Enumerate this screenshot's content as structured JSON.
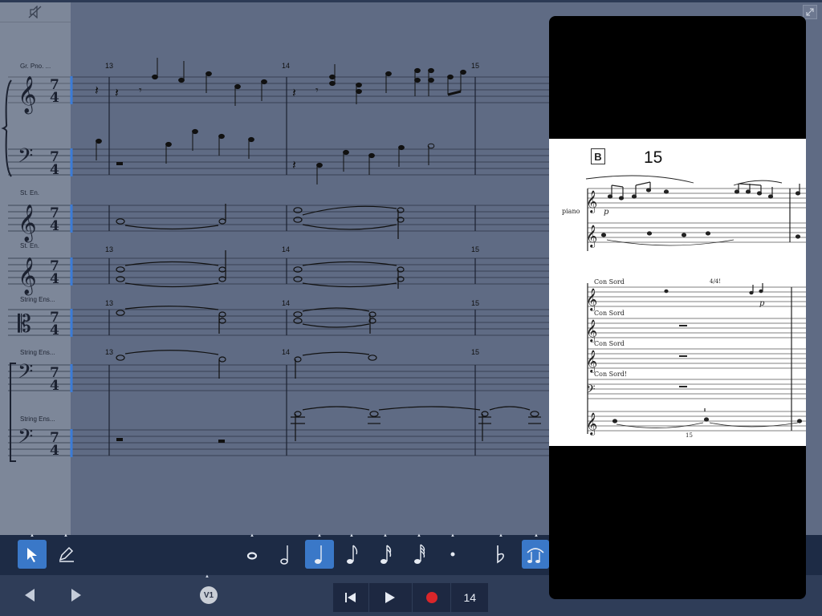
{
  "score": {
    "labels": [
      "Gr. Pno. ...",
      "St. En.",
      "St. En.",
      "String Ens...",
      "String Ens...",
      "String Ens..."
    ],
    "measures": [
      "13",
      "14",
      "15"
    ],
    "time_signature_top": "7",
    "time_signature_bottom": "4"
  },
  "toolbar": {
    "tools": [
      {
        "icon": "pointer-icon",
        "active": true
      },
      {
        "icon": "pencil-icon",
        "active": false
      }
    ],
    "note_values": [
      {
        "icon": "whole-note-icon",
        "active": false
      },
      {
        "icon": "half-note-icon",
        "active": false
      },
      {
        "icon": "quarter-note-icon",
        "active": true
      },
      {
        "icon": "eighth-note-icon",
        "active": false
      },
      {
        "icon": "sixteenth-note-icon",
        "active": false
      },
      {
        "icon": "thirty-second-note-icon",
        "active": false
      },
      {
        "icon": "dot-icon",
        "active": false
      },
      {
        "icon": "flat-icon",
        "active": false
      },
      {
        "icon": "tie-icon",
        "active": true
      }
    ]
  },
  "transport": {
    "voice": "V1",
    "measure": "14"
  },
  "reference_sheet": {
    "rehearsal_mark": "B",
    "bar_number": "15",
    "instrument": "piano",
    "dynamic_1": "p",
    "dynamic_2": "p",
    "tempo_mark": "4/4!",
    "con_sord_1": "Con Sord",
    "con_sord_2": "Con Sord",
    "con_sord_3": "Con Sord",
    "con_sord_4": "Con Sord!",
    "footer_number": "15"
  }
}
